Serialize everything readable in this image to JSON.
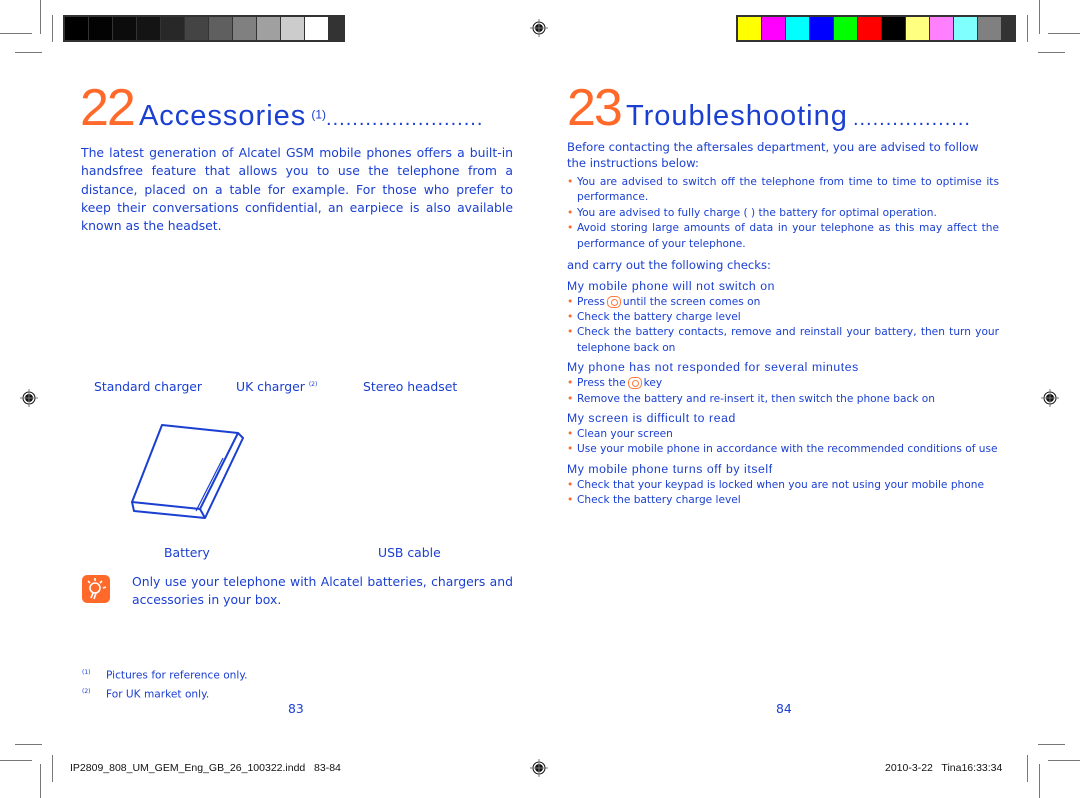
{
  "marks": {
    "gray_swatches": [
      "#000000",
      "#030303",
      "#0c0c0c",
      "#141414",
      "#282828",
      "#444444",
      "#5f5f5f",
      "#808080",
      "#a0a0a0",
      "#cccccc",
      "#ffffff"
    ],
    "color_swatches": [
      "#ffff00",
      "#ff00ff",
      "#00ffff",
      "#0000ff",
      "#00ff00",
      "#ff0000",
      "#000000",
      "#ffff80",
      "#ff80ff",
      "#80ffff",
      "#808080"
    ]
  },
  "colors": {
    "accent_orange": "#ff6a2b",
    "text_blue": "#1a3fd1"
  },
  "left_page": {
    "chapter_number": "22",
    "chapter_title": "Accessories",
    "chapter_sup": "(1)",
    "chapter_dots": "........................",
    "intro": "The latest generation of Alcatel GSM mobile phones offers a built-in handsfree feature that allows you to use the telephone from a distance, placed on a table for example. For those who prefer to keep their conversations confidential, an earpiece is also available known as the headset.",
    "accessories": [
      {
        "label": "Standard charger",
        "sup": ""
      },
      {
        "label": "UK charger",
        "sup": "(2)"
      },
      {
        "label": "Stereo headset",
        "sup": ""
      },
      {
        "label": "Battery",
        "sup": ""
      },
      {
        "label": "USB cable",
        "sup": ""
      }
    ],
    "note_icon": "lightbulb-icon",
    "note": "Only use your telephone with Alcatel batteries, chargers and accessories in your box.",
    "footnotes": [
      {
        "mark": "(1)",
        "text": "Pictures for reference only."
      },
      {
        "mark": "(2)",
        "text": "For UK market only."
      }
    ],
    "page_number": "83"
  },
  "right_page": {
    "chapter_number": "23",
    "chapter_title": "Troubleshooting",
    "chapter_dots": "..................",
    "intro": "Before contacting the aftersales department, you are advised to follow the instructions below:",
    "advice": [
      "You are advised to switch off the telephone from time to time to optimise its performance.",
      "You are advised to fully charge (        ) the battery for optimal operation.",
      "Avoid storing large amounts of data in your telephone as this may affect the performance of your telephone."
    ],
    "checks_intro": "and carry out the following checks:",
    "sections": [
      {
        "title": "My mobile phone will not switch on",
        "items": [
          {
            "pre": "Press",
            "key": true,
            "post": "until the screen comes on"
          },
          {
            "pre": "Check the battery charge level",
            "key": false,
            "post": ""
          },
          {
            "pre": "Check the battery contacts, remove and reinstall your battery, then turn your telephone back on",
            "key": false,
            "post": ""
          }
        ]
      },
      {
        "title": "My phone has not responded for several minutes",
        "items": [
          {
            "pre": "Press the",
            "key": true,
            "post": "key"
          },
          {
            "pre": "Remove the battery and re-insert it, then switch the phone back on",
            "key": false,
            "post": ""
          }
        ]
      },
      {
        "title": "My screen is difficult to read",
        "items": [
          {
            "pre": "Clean your screen",
            "key": false,
            "post": ""
          },
          {
            "pre": "Use your mobile phone in accordance with the recommended conditions of use",
            "key": false,
            "post": ""
          }
        ]
      },
      {
        "title": "My mobile phone turns off by itself",
        "items": [
          {
            "pre": "Check that your keypad is locked when you are not using your mobile phone",
            "key": false,
            "post": ""
          },
          {
            "pre": "Check the battery charge level",
            "key": false,
            "post": ""
          }
        ]
      }
    ],
    "page_number": "84"
  },
  "slug": {
    "file": "IP2809_808_UM_GEM_Eng_GB_26_100322.indd   83-84",
    "stamp": "2010-3-22   Tina16:33:34"
  }
}
